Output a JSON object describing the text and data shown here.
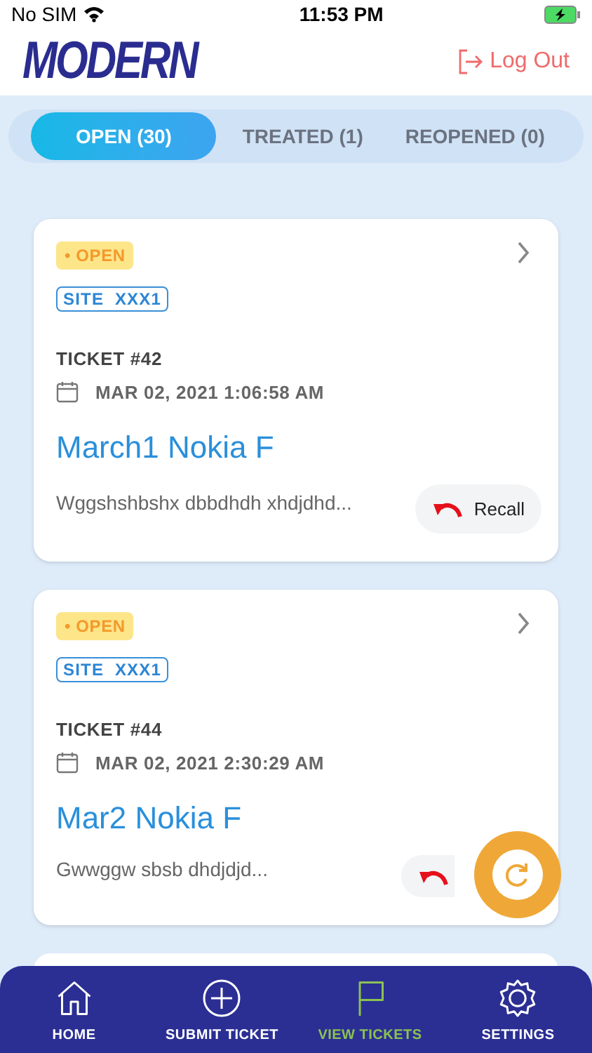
{
  "status_bar": {
    "carrier": "No SIM",
    "time": "11:53 PM"
  },
  "header": {
    "logo": "MODERN",
    "logout": "Log Out"
  },
  "tabs": [
    {
      "label": "OPEN (30)",
      "selected": true
    },
    {
      "label": "TREATED (1)",
      "selected": false
    },
    {
      "label": "REOPENED (0)",
      "selected": false
    }
  ],
  "tickets": [
    {
      "status": "• OPEN",
      "site": "SITE  XXX1",
      "number": "TICKET #42",
      "date": "MAR 02, 2021 1:06:58 AM",
      "title": "March1 Nokia F",
      "description": "Wggshshbshx dbbdhdh xhdjdhd...",
      "recall": "Recall"
    },
    {
      "status": "• OPEN",
      "site": "SITE  XXX1",
      "number": "TICKET #44",
      "date": "MAR 02, 2021 2:30:29 AM",
      "title": "Mar2 Nokia F",
      "description": "Gwwggw sbsb dhdjdjd..."
    }
  ],
  "bottom_nav": [
    {
      "label": "HOME",
      "kind": "home",
      "selected": false
    },
    {
      "label": "SUBMIT TICKET",
      "kind": "plus",
      "selected": false
    },
    {
      "label": "VIEW TICKETS",
      "kind": "flag",
      "selected": true
    },
    {
      "label": "SETTINGS",
      "kind": "gear",
      "selected": false
    }
  ]
}
